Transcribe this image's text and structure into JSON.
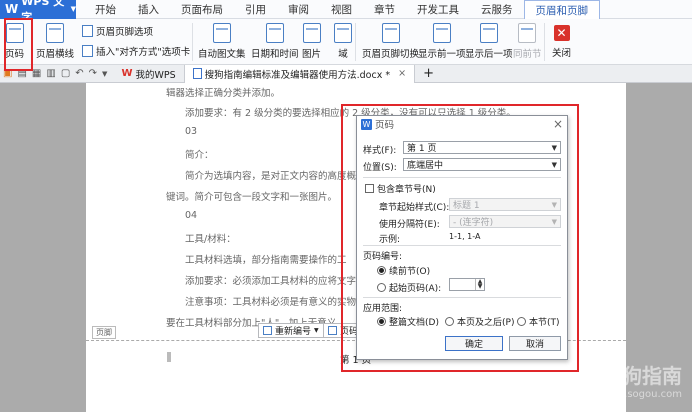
{
  "app": {
    "name": "WPS 文字"
  },
  "menu": [
    "开始",
    "插入",
    "页面布局",
    "引用",
    "审阅",
    "视图",
    "章节",
    "开发工具",
    "云服务",
    "页眉和页脚"
  ],
  "active_menu": "页眉和页脚",
  "ribbon": {
    "page_number": "页码",
    "header_line": "页眉横线",
    "header_footer_options": "页眉页脚选项",
    "insert_align_tab": "插入\"对齐方式\"选项卡",
    "text_part": "自动图文集",
    "date_time": "日期和时间",
    "picture": "图片",
    "field": "域",
    "header_footer_switch": "页眉页脚切换",
    "show_prev": "显示前一项",
    "show_next": "显示后一项",
    "same_as_prev": "同前节",
    "close": "关闭"
  },
  "tabs": {
    "home": "我的WPS",
    "doc": "搜狗指南编辑标准及编辑器使用方法.docx *",
    "add": "+"
  },
  "document": {
    "lines": [
      "辑器选择正确分类并添加。",
      "添加要求：有 2 级分类的要选择相应的 2 级分类，没有可以只选择 1 级分类。",
      "03",
      "简介：",
      "简介为选填内容，是对正文内容的高度概括",
      "键词。简介可包含一段文字和一张图片。",
      "04",
      "工具/材料：",
      "工具材料选填，部分指南需要操作的工",
      "添加要求：必须添加工具材料的应将文字",
      "注意事项：工具材料必须是有意义的实物",
      "要在工具材料部分加上\"人\"，加上无意义"
    ],
    "footer_tag": "页脚",
    "renumber_btn": "重新编号",
    "page_btn": "页码",
    "page_number_text": "第 1 页"
  },
  "dialog": {
    "title": "页码",
    "style_label": "样式(F):",
    "style_value": "第 1 页",
    "position_label": "位置(S):",
    "position_value": "底端居中",
    "include_chapter": "包含章节号(N)",
    "chapter_start_label": "章节起始样式(C):",
    "chapter_start_value": "标题 1",
    "separator_label": "使用分隔符(E):",
    "separator_value": "-  (连字符)",
    "example_label": "示例:",
    "example_value": "1-1, 1-A",
    "numbering_label": "页码编号:",
    "continue_prev": "续前节(O)",
    "start_number": "起始页码(A):",
    "apply_label": "应用范围:",
    "whole_doc": "整篇文档(D)",
    "this_page_after": "本页及之后(P)",
    "this_section": "本节(T)",
    "ok": "确定",
    "cancel": "取消"
  },
  "watermark": {
    "cn": "搜狗指南",
    "en": "zhinan.sogou.com"
  },
  "colors": {
    "accent": "#2c6fd6",
    "highlight": "#e0262a"
  }
}
